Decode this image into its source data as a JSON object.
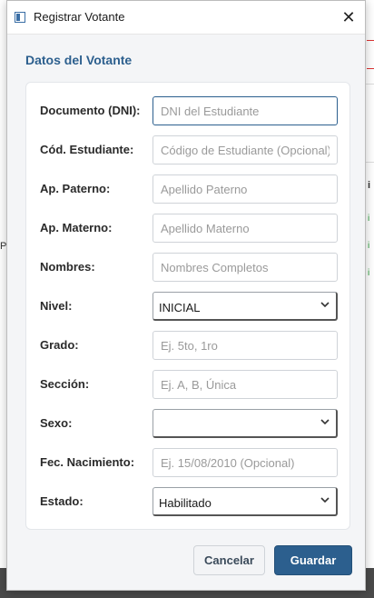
{
  "window": {
    "title": "Registrar Votante",
    "close_glyph": "✕"
  },
  "section_title": "Datos del Votante",
  "fields": [
    {
      "label": "Documento (DNI):",
      "placeholder": "DNI del Estudiante",
      "type": "text",
      "value": ""
    },
    {
      "label": "Cód. Estudiante:",
      "placeholder": "Código de Estudiante (Opcional)",
      "type": "text",
      "value": ""
    },
    {
      "label": "Ap. Paterno:",
      "placeholder": "Apellido Paterno",
      "type": "text",
      "value": ""
    },
    {
      "label": "Ap. Materno:",
      "placeholder": "Apellido Materno",
      "type": "text",
      "value": ""
    },
    {
      "label": "Nombres:",
      "placeholder": "Nombres Completos",
      "type": "text",
      "value": ""
    },
    {
      "label": "Nivel:",
      "type": "select",
      "value": "INICIAL"
    },
    {
      "label": "Grado:",
      "placeholder": "Ej. 5to, 1ro",
      "type": "text",
      "value": ""
    },
    {
      "label": "Sección:",
      "placeholder": "Ej. A, B, Única",
      "type": "text",
      "value": ""
    },
    {
      "label": "Sexo:",
      "type": "select",
      "value": ""
    },
    {
      "label": "Fec. Nacimiento:",
      "placeholder": "Ej. 15/08/2010 (Opcional)",
      "type": "text",
      "value": ""
    },
    {
      "label": "Estado:",
      "type": "select",
      "value": "Habilitado"
    }
  ],
  "buttons": {
    "cancel": "Cancelar",
    "save": "Guardar"
  },
  "colors": {
    "accent": "#2c5f8e",
    "background": "#f4f5f7"
  },
  "background_app": {
    "left_fragment": "P",
    "right_fragment": "i"
  }
}
